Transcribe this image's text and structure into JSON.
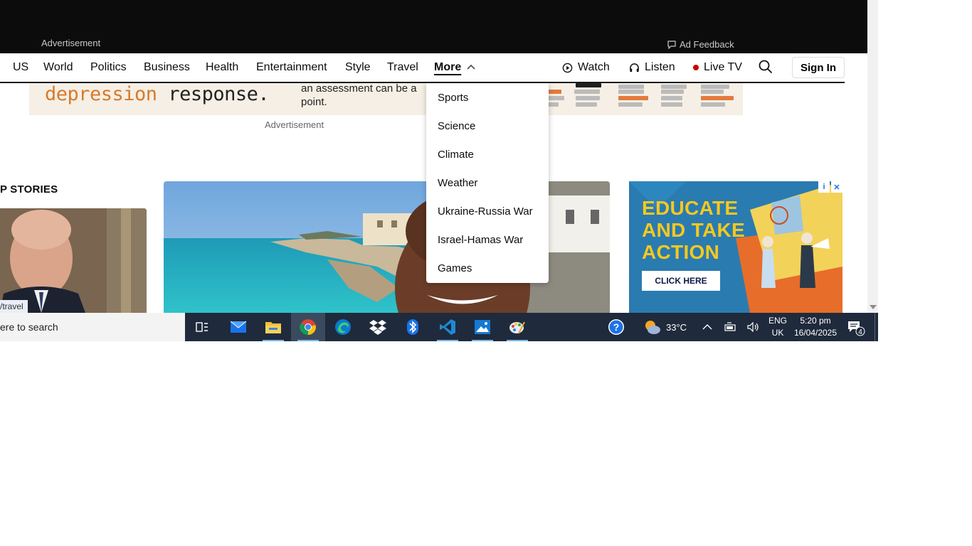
{
  "topbar": {
    "advertisement_label": "Advertisement",
    "ad_feedback_label": "Ad Feedback"
  },
  "nav": {
    "items": [
      "US",
      "World",
      "Politics",
      "Business",
      "Health",
      "Entertainment",
      "Style",
      "Travel"
    ],
    "more_label": "More",
    "watch_label": "Watch",
    "listen_label": "Listen",
    "live_tv_label": "Live TV",
    "sign_in_label": "Sign In",
    "live_dot_color": "#cc0000"
  },
  "banner_ad": {
    "headline_word_1": "depression",
    "headline_word_2": "response.",
    "body_line_1": "an assessment can be a",
    "body_line_2": "point.",
    "accent_color": "#d77a2a"
  },
  "advertisement_label_2": "Advertisement",
  "top_stories": {
    "title": "P STORIES",
    "left_card_caption": "/travel"
  },
  "more_menu": {
    "items": [
      "Sports",
      "Science",
      "Climate",
      "Weather",
      "Ukraine-Russia War",
      "Israel-Hamas War",
      "Games"
    ]
  },
  "right_ad": {
    "headline_lines": [
      "EDUCATE",
      "AND TAKE",
      "ACTION"
    ],
    "cta_label": "CLICK HERE",
    "headline_color": "#f6c81e"
  },
  "taskbar": {
    "search_placeholder": "ere to search",
    "apps": [
      "task-view-icon",
      "mail-icon",
      "file-explorer-icon",
      "chrome-icon",
      "edge-icon",
      "dropbox-icon",
      "bluetooth-icon",
      "vscode-icon",
      "photos-icon",
      "paint-icon"
    ],
    "help_icon": "help-icon",
    "weather_temp": "33°C",
    "lang_line_1": "ENG",
    "lang_line_2": "UK",
    "time": "5:20 pm",
    "date": "16/04/2025",
    "notification_count": "4"
  }
}
